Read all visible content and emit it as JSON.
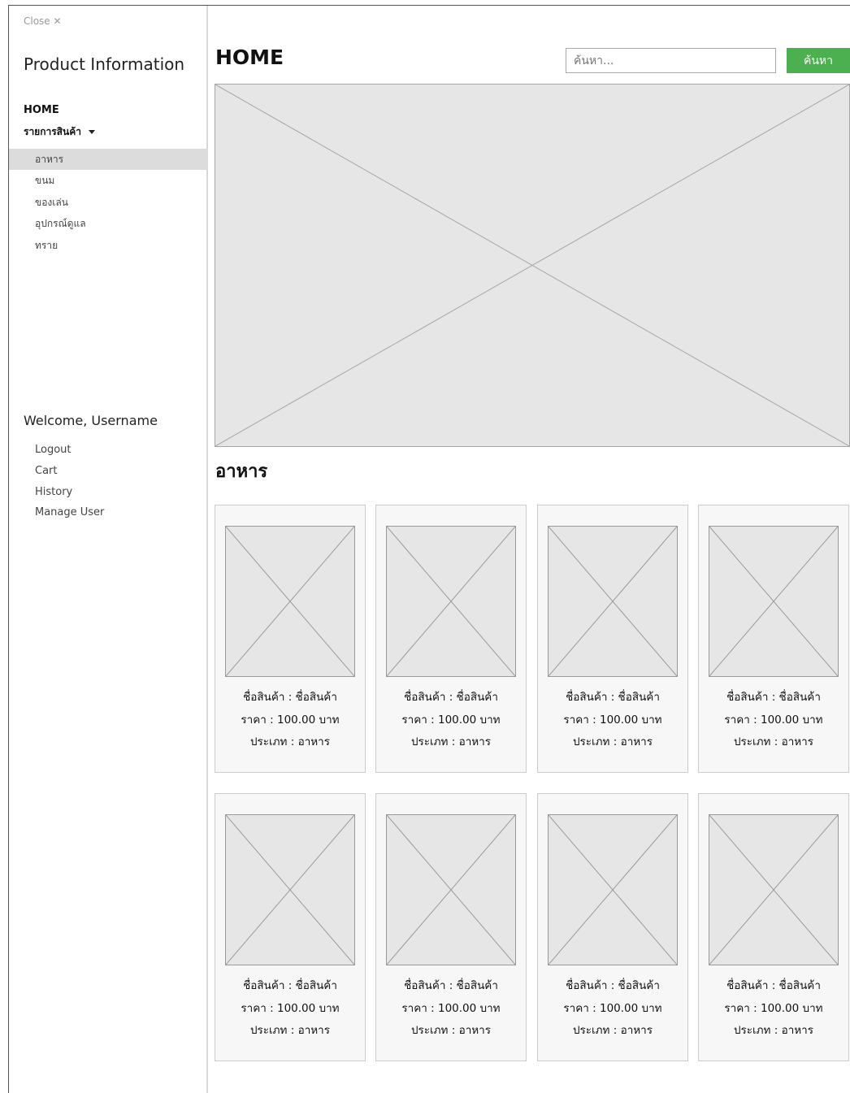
{
  "sidebar": {
    "close_label": "Close ✕",
    "brand": "Product Information",
    "home_label": "HOME",
    "products_label": "รายการสินค้า",
    "categories": [
      {
        "label": "อาหาร",
        "active": true
      },
      {
        "label": "ขนม",
        "active": false
      },
      {
        "label": "ของเล่น",
        "active": false
      },
      {
        "label": "อุปกรณ์ดูแล",
        "active": false
      },
      {
        "label": "ทราย",
        "active": false
      }
    ],
    "welcome": "Welcome, Username",
    "user_links": [
      "Logout",
      "Cart",
      "History",
      "Manage User"
    ]
  },
  "header": {
    "title": "HOME",
    "search_placeholder": "ค้นหา...",
    "search_button": "ค้นหา"
  },
  "section": {
    "title": "อาหาร"
  },
  "products": [
    {
      "name": "ชื่อสินค้า : ชื่อสินค้า",
      "price": "ราคา :  100.00 บาท",
      "type": "ประเภท :  อาหาร"
    },
    {
      "name": "ชื่อสินค้า : ชื่อสินค้า",
      "price": "ราคา :  100.00 บาท",
      "type": "ประเภท :  อาหาร"
    },
    {
      "name": "ชื่อสินค้า : ชื่อสินค้า",
      "price": "ราคา :  100.00 บาท",
      "type": "ประเภท :  อาหาร"
    },
    {
      "name": "ชื่อสินค้า : ชื่อสินค้า",
      "price": "ราคา :  100.00 บาท",
      "type": "ประเภท :  อาหาร"
    },
    {
      "name": "ชื่อสินค้า : ชื่อสินค้า",
      "price": "ราคา :  100.00 บาท",
      "type": "ประเภท :  อาหาร"
    },
    {
      "name": "ชื่อสินค้า : ชื่อสินค้า",
      "price": "ราคา :  100.00 บาท",
      "type": "ประเภท :  อาหาร"
    },
    {
      "name": "ชื่อสินค้า : ชื่อสินค้า",
      "price": "ราคา :  100.00 บาท",
      "type": "ประเภท :  อาหาร"
    },
    {
      "name": "ชื่อสินค้า : ชื่อสินค้า",
      "price": "ราคา :  100.00 บาท",
      "type": "ประเภท :  อาหาร"
    }
  ],
  "colors": {
    "accent": "#4caf50",
    "active_item": "#dcdcdc",
    "placeholder_fill": "#e6e6e6"
  }
}
